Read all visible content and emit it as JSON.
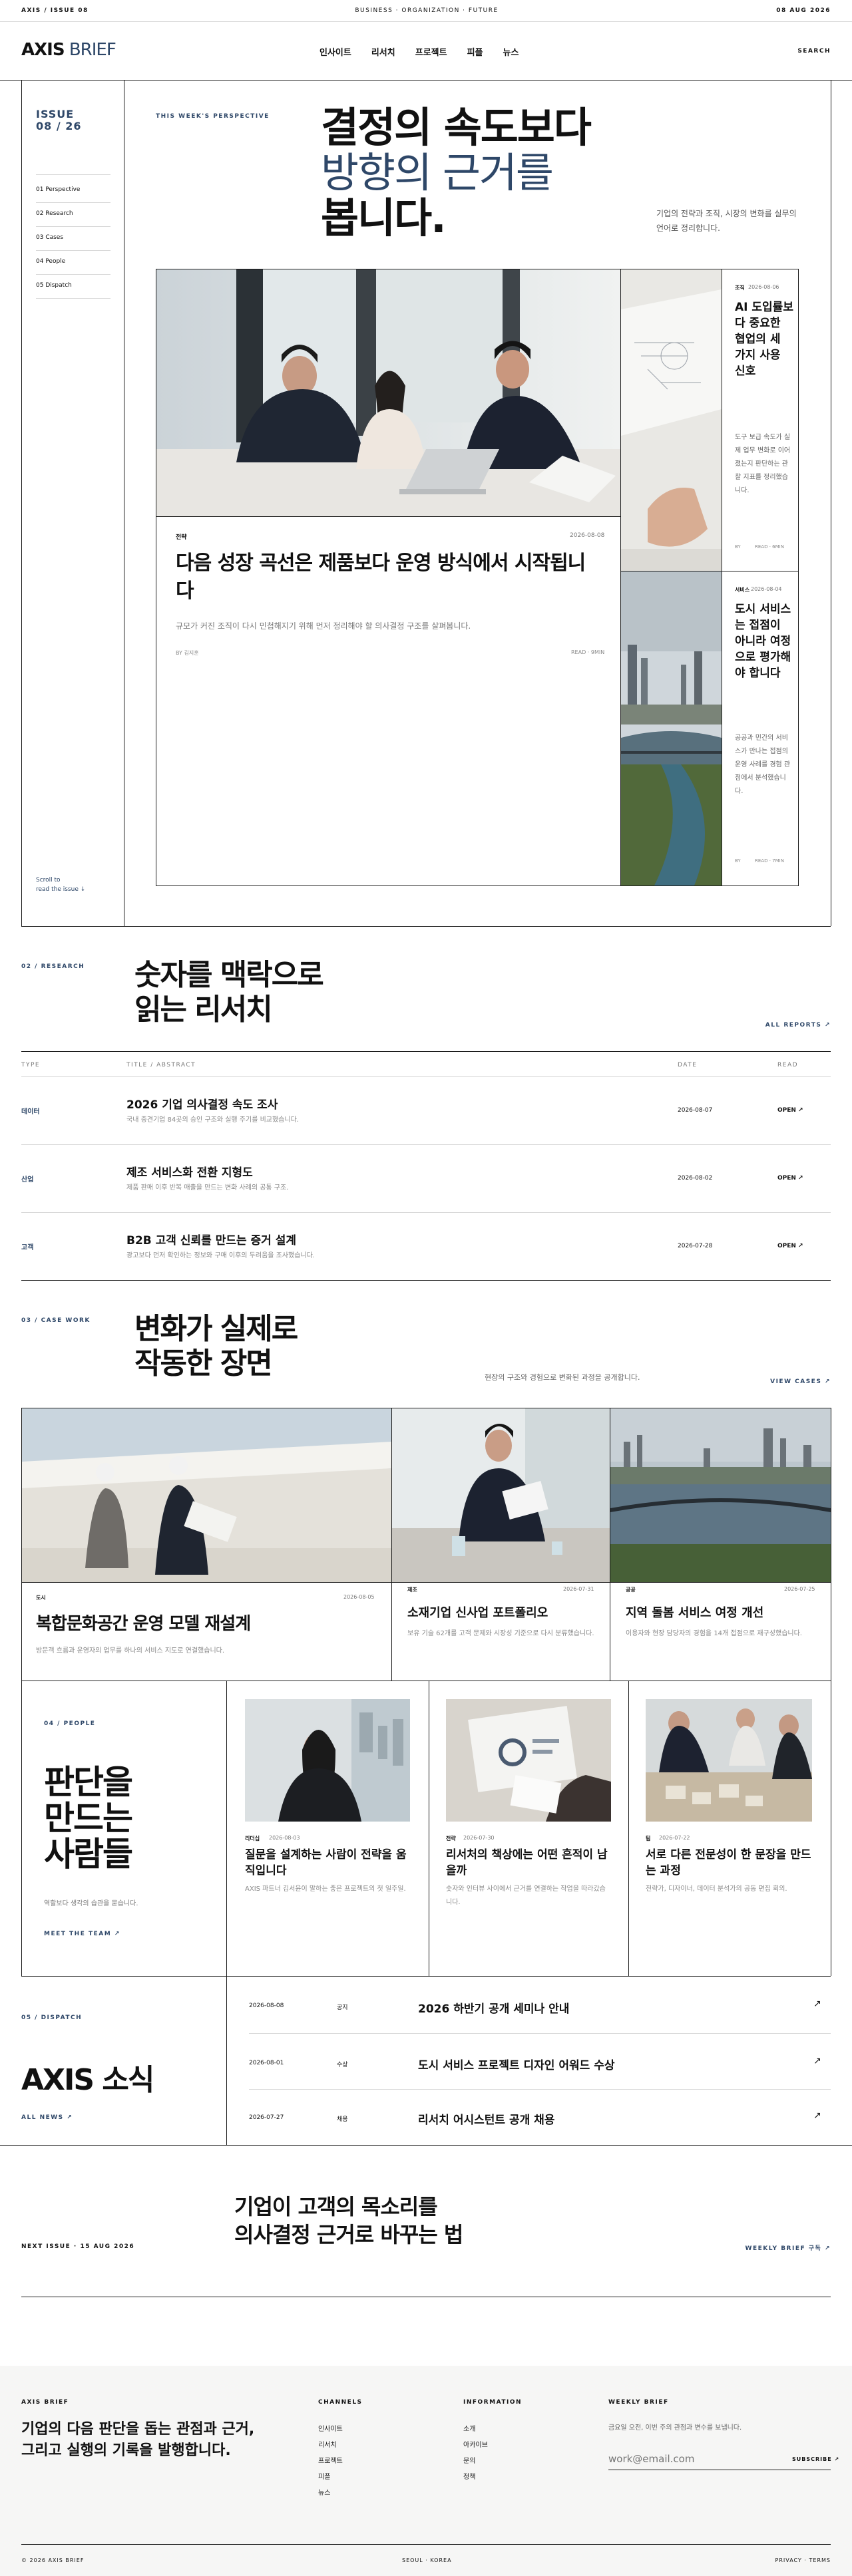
{
  "top": {
    "left": "AXIS / ISSUE 08",
    "center": "BUSINESS · ORGANIZATION · FUTURE",
    "right": "08 AUG 2026"
  },
  "header": {
    "logo_a": "AXIS",
    "logo_b": "BRIEF",
    "nav": [
      "인사이트",
      "리서치",
      "프로젝트",
      "피플",
      "뉴스"
    ],
    "search": "SEARCH"
  },
  "sidebar": {
    "issue_label": "ISSUE",
    "issue_no": "08 / 26",
    "items": [
      "01 Perspective",
      "02 Research",
      "03 Cases",
      "04 People",
      "05 Dispatch"
    ],
    "scroll": "Scroll to\nread the issue ↓"
  },
  "hero": {
    "eyebrow": "THIS WEEK'S PERSPECTIVE",
    "title_1": "결정의 속도보다",
    "title_2": "방향의 근거를",
    "title_3": "봅니다.",
    "intro": "기업의 전략과 조직, 시장의 변화를 실무의 언어로 정리합니다."
  },
  "feature": {
    "tag": "전략",
    "date": "2026-08-08",
    "title": "다음 성장 곡선은 제품보다 운영 방식에서 시작됩니다",
    "desc": "규모가 커진 조직이 다시 민첩해지기 위해 먼저 정리해야 할 의사결정 구조를 살펴봅니다.",
    "by": "BY 김지훈",
    "read": "READ · 9MIN"
  },
  "side1": {
    "tag": "조직",
    "date": "2026-08-06",
    "title": "AI 도입률보다 중요한 협업의 세 가지 사용 신호",
    "desc": "도구 보급 속도가 실제 업무 변화로 이어졌는지 판단하는 관찰 지표를 정리했습니다.",
    "by": "BY",
    "read": "READ · 6MIN"
  },
  "side2": {
    "tag": "서비스",
    "date": "2026-08-04",
    "title": "도시 서비스는 접점이 아니라 여정으로 평가해야 합니다",
    "desc": "공공과 민간의 서비스가 만나는 접점의 운영 사례를 경험 관점에서 분석했습니다.",
    "by": "BY",
    "read": "READ · 7MIN"
  },
  "research": {
    "label": "02 / RESEARCH",
    "title_1": "숫자를 맥락으로",
    "title_2": "읽는 리서치",
    "all": "ALL REPORTS ↗",
    "cols": [
      "TYPE",
      "TITLE / ABSTRACT",
      "DATE",
      "READ"
    ],
    "rows": [
      {
        "type": "데이터",
        "title": "2026 기업 의사결정 속도 조사",
        "abs": "국내 중견기업 84곳의 승인 구조와 실행 주기를 비교했습니다.",
        "date": "2026-08-07",
        "read": "OPEN ↗"
      },
      {
        "type": "산업",
        "title": "제조 서비스화 전환 지형도",
        "abs": "제품 판매 이후 반복 매출을 만드는 변화 사례의 공통 구조.",
        "date": "2026-08-02",
        "read": "OPEN ↗"
      },
      {
        "type": "고객",
        "title": "B2B 고객 신뢰를 만드는 증거 설계",
        "abs": "광고보다 먼저 확인하는 정보와 구매 이후의 두려움을 조사했습니다.",
        "date": "2026-07-28",
        "read": "OPEN ↗"
      }
    ]
  },
  "cases": {
    "label": "03 / CASE WORK",
    "title_1": "변화가 실제로",
    "title_2": "작동한 장면",
    "intro": "현장의 구조와 경험으로 변화된 과정을 공개합니다.",
    "all": "VIEW CASES ↗",
    "items": [
      {
        "tag": "도시",
        "date": "2026-08-05",
        "title": "복합문화공간 운영 모델 재설계",
        "desc": "방문객 흐름과 운영자의 업무를 하나의 서비스 지도로 연결했습니다."
      },
      {
        "tag": "제조",
        "date": "2026-07-31",
        "title": "소재기업 신사업 포트폴리오",
        "desc": "보유 기술 62개를 고객 문제와 시장성 기준으로 다시 분류했습니다."
      },
      {
        "tag": "공공",
        "date": "2026-07-25",
        "title": "지역 돌봄 서비스 여정 개선",
        "desc": "이용자와 현장 담당자의 경험을 14개 접점으로 재구성했습니다."
      }
    ]
  },
  "people": {
    "label": "04 / PEOPLE",
    "title_1": "판단을",
    "title_2": "만드는",
    "title_3": "사람들",
    "desc": "역할보다 생각의 습관을 묻습니다.",
    "cta": "MEET THE TEAM ↗",
    "items": [
      {
        "role": "리더십",
        "date": "2026-08-03",
        "title": "질문을 설계하는 사람이 전략을 움직입니다",
        "desc": "AXIS 파트너 김서윤이 말하는 좋은 프로젝트의 첫 일주일."
      },
      {
        "role": "전략",
        "date": "2026-07-30",
        "title": "리서처의 책상에는 어떤 흔적이 남을까",
        "desc": "숫자와 인터뷰 사이에서 근거를 연결하는 작업을 따라갔습니다."
      },
      {
        "role": "팀",
        "date": "2026-07-22",
        "title": "서로 다른 전문성이 한 문장을 만드는 과정",
        "desc": "전략가, 디자이너, 데이터 분석가의 공동 편집 회의."
      }
    ]
  },
  "dispatch": {
    "label": "05 / DISPATCH",
    "title": "AXIS 소식",
    "all": "ALL NEWS ↗",
    "rows": [
      {
        "date": "2026-08-08",
        "tag": "공지",
        "title": "2026 하반기 공개 세미나 안내"
      },
      {
        "date": "2026-08-01",
        "tag": "수상",
        "title": "도시 서비스 프로젝트 디자인 어워드 수상"
      },
      {
        "date": "2026-07-27",
        "tag": "채용",
        "title": "리서치 어시스턴트 공개 채용"
      }
    ]
  },
  "next": {
    "label": "NEXT ISSUE · 15 AUG 2026",
    "title_1": "기업이 고객의 목소리를",
    "title_2": "의사결정 근거로 바꾸는 법",
    "cta": "WEEKLY BRIEF 구독 ↗"
  },
  "footer": {
    "brand": "AXIS BRIEF",
    "tagline_1": "기업의 다음 판단을 돕는 관점과 근거,",
    "tagline_2": "그리고 실행의 기록을 발행합니다.",
    "ch_title": "CHANNELS",
    "channels": [
      "인사이트",
      "리서치",
      "프로젝트",
      "피플",
      "뉴스"
    ],
    "info_title": "INFORMATION",
    "info": [
      "소개",
      "아카이브",
      "문의",
      "정책"
    ],
    "wk_title": "WEEKLY BRIEF",
    "wk_desc": "금요일 오전, 이번 주의 관점과 변수를 보냅니다.",
    "email_ph": "work@email.com",
    "subscribe": "SUBSCRIBE ↗",
    "copy": "© 2026 AXIS BRIEF",
    "city": "SEOUL · KOREA",
    "legal": "PRIVACY · TERMS"
  },
  "colors": {
    "navy": "#2e4768",
    "ink": "#111111",
    "line": "#1a1a1a"
  }
}
